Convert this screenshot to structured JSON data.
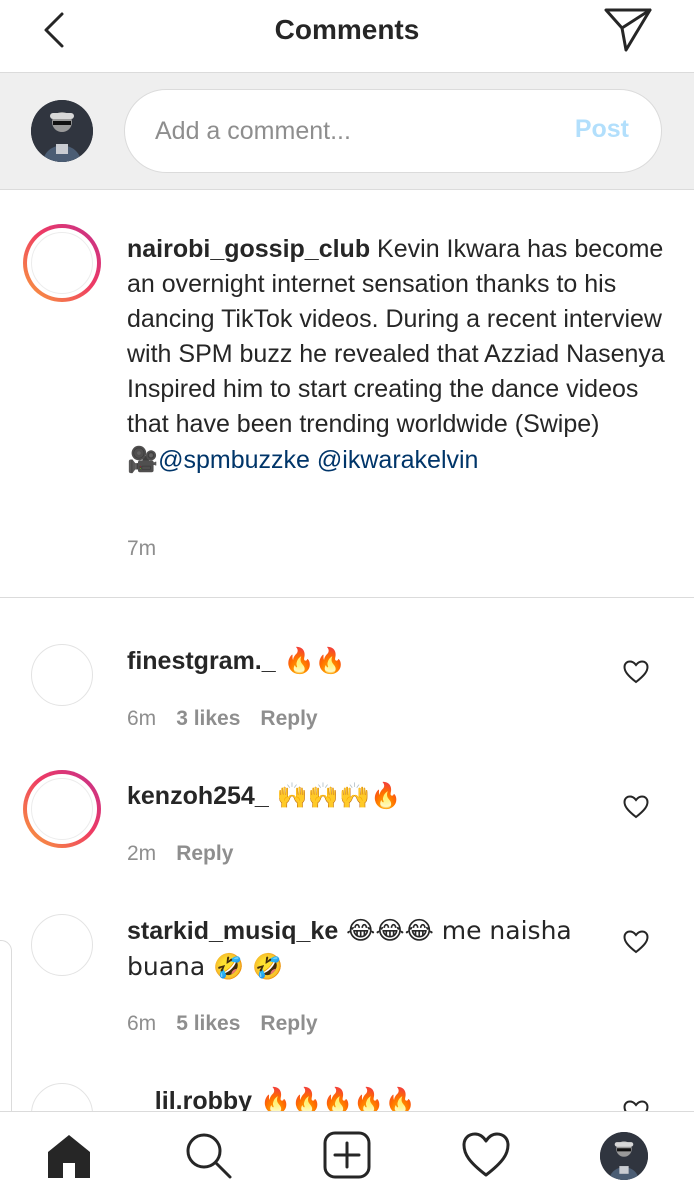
{
  "header": {
    "title": "Comments"
  },
  "compose": {
    "placeholder": "Add a comment...",
    "post_label": "Post"
  },
  "caption": {
    "username": "nairobi_gossip_club",
    "text": " Kevin Ikwara has become an overnight internet sensation thanks to his dancing TikTok videos. During a recent interview with SPM buzz he revealed that Azziad Nasenya Inspired him to start creating the dance videos that have been trending worldwide (Swipe)",
    "camera_emoji": "🎥",
    "mention1": "@spmbuzzke",
    "mention2": "@ikwarakelvin",
    "time": "7m"
  },
  "comments": [
    {
      "username": "finestgram._",
      "text": " 🔥🔥",
      "time": "6m",
      "likes": "3 likes",
      "reply": "Reply"
    },
    {
      "username": "kenzoh254_",
      "text": " 🙌🙌🙌🔥",
      "time": "2m",
      "reply": "Reply"
    },
    {
      "username": "starkid_musiq_ke",
      "text": " 😂😂😂 me naisha buana 🤣 🤣",
      "time": "6m",
      "likes": "5 likes",
      "reply": "Reply"
    },
    {
      "username": "__lil.robby",
      "text": " 🔥🔥🔥🔥🔥"
    }
  ],
  "colors": {
    "link": "#003569",
    "post_disabled": "#b2dffc",
    "ring_gradient": [
      "#f9a23b",
      "#ee3a64",
      "#c1308e"
    ]
  },
  "icons": {
    "back": "chevron-left-icon",
    "share": "paper-plane-icon",
    "nav": [
      "home-icon",
      "search-icon",
      "add-icon",
      "heart-icon",
      "profile-avatar"
    ]
  }
}
